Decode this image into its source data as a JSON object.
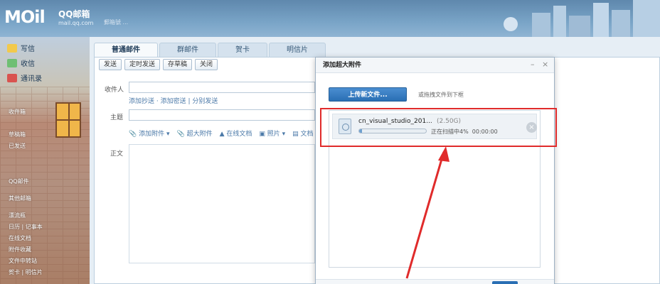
{
  "header": {
    "logo": "MOil",
    "brand": "QQ邮箱",
    "domain": "mail.qq.com",
    "user": "郵箱號 ..."
  },
  "sidebar": {
    "items": [
      {
        "label": "写信",
        "icon": "pencil-icon"
      },
      {
        "label": "收信",
        "icon": "inbox-icon"
      },
      {
        "label": "通讯录",
        "icon": "contacts-icon"
      }
    ],
    "links": [
      "收件箱",
      "草稿箱",
      "已发送",
      "QQ邮件",
      "其他邮箱",
      "漂流瓶",
      "日历 | 记事本",
      "在线文档",
      "附件收藏",
      "文件中转站",
      "贺卡 | 明信片"
    ]
  },
  "compose": {
    "tabs": [
      "普通邮件",
      "群邮件",
      "贺卡",
      "明信片"
    ],
    "toolbar": [
      "发送",
      "定时发送",
      "存草稿",
      "关闭"
    ],
    "to_label": "收件人",
    "cc_links": "添加抄送 · 添加密送 | 分别发送",
    "subject_label": "主题",
    "attach": [
      "添加附件",
      "超大附件",
      "在线文档",
      "照片",
      "文档"
    ],
    "body_label": "正文"
  },
  "dialog": {
    "title": "添加超大附件",
    "minimize": "–",
    "close": "×",
    "upload_button": "上传新文件...",
    "drag_hint": "或拖拽文件到下框",
    "file": {
      "name": "cn_visual_studio_201...",
      "size": "(2.50G)",
      "status": "正在扫描中4%",
      "time": "00:00:00",
      "progress": 0.04
    }
  },
  "colors": {
    "accent": "#2a6fb4",
    "annotation": "#e02b2b"
  }
}
